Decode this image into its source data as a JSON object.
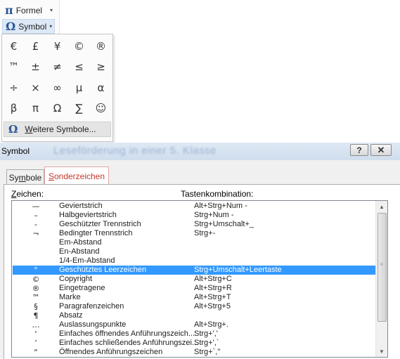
{
  "ribbon": {
    "formel": {
      "icon": "π",
      "label": "Formel",
      "caret": "▾"
    },
    "symbol": {
      "icon": "Ω",
      "label": "Symbol",
      "caret": "▾"
    }
  },
  "gallery": {
    "symbols": [
      "€",
      "£",
      "¥",
      "©",
      "®",
      "™",
      "±",
      "≠",
      "≤",
      "≥",
      "÷",
      "×",
      "∞",
      "µ",
      "α",
      "β",
      "π",
      "Ω",
      "∑",
      "☺"
    ],
    "more": {
      "icon": "Ω",
      "label_first": "W",
      "label_rest": "eitere Symbole..."
    }
  },
  "dialog": {
    "title": "Symbol",
    "ghost_title": "Leseförderung in einer 5. Klasse",
    "help": "?",
    "close": "✕",
    "tabs": {
      "symbole": {
        "first": "Sy",
        "underlined": "m",
        "rest": "bole"
      },
      "sonder": {
        "underlined": "S",
        "rest": "onderzeichen"
      }
    },
    "headers": {
      "zeichen_underlined": "Z",
      "zeichen_rest": "eichen:",
      "tasten": "Tastenkombination:"
    },
    "rows": [
      {
        "char": "—",
        "name": "Geviertstrich",
        "keys": "Alt+Strg+Num -"
      },
      {
        "char": "–",
        "name": "Halbgeviertstrich",
        "keys": "Strg+Num -"
      },
      {
        "char": "-",
        "name": "Geschützter Trennstrich",
        "keys": "Strg+Umschalt+_"
      },
      {
        "char": "¬",
        "name": "Bedingter Trennstrich",
        "keys": "Strg+-"
      },
      {
        "char": "",
        "name": "Em-Abstand",
        "keys": ""
      },
      {
        "char": "",
        "name": "En-Abstand",
        "keys": ""
      },
      {
        "char": "",
        "name": "1/4-Em-Abstand",
        "keys": ""
      },
      {
        "char": "°",
        "name": "Geschütztes Leerzeichen",
        "keys": "Strg+Umschalt+Leertaste"
      },
      {
        "char": "©",
        "name": "Copyright",
        "keys": "Alt+Strg+C"
      },
      {
        "char": "®",
        "name": "Eingetragene",
        "keys": "Alt+Strg+R"
      },
      {
        "char": "™",
        "name": "Marke",
        "keys": "Alt+Strg+T"
      },
      {
        "char": "§",
        "name": "Paragrafenzeichen",
        "keys": "Alt+Strg+5"
      },
      {
        "char": "¶",
        "name": "Absatz",
        "keys": ""
      },
      {
        "char": "…",
        "name": "Auslassungspunkte",
        "keys": "Alt+Strg+."
      },
      {
        "char": "‘",
        "name": "Einfaches öffnendes Anführungszeich...",
        "keys": "Strg+','"
      },
      {
        "char": "’",
        "name": "Einfaches schließendes Anführungszei...",
        "keys": "Strg+',`"
      },
      {
        "char": "“",
        "name": "Öffnendes Anführungszeichen",
        "keys": "Strg+`,\""
      }
    ],
    "selected_index": 7,
    "scroll": {
      "up": "▲",
      "down": "▼",
      "grip": "≡"
    }
  }
}
